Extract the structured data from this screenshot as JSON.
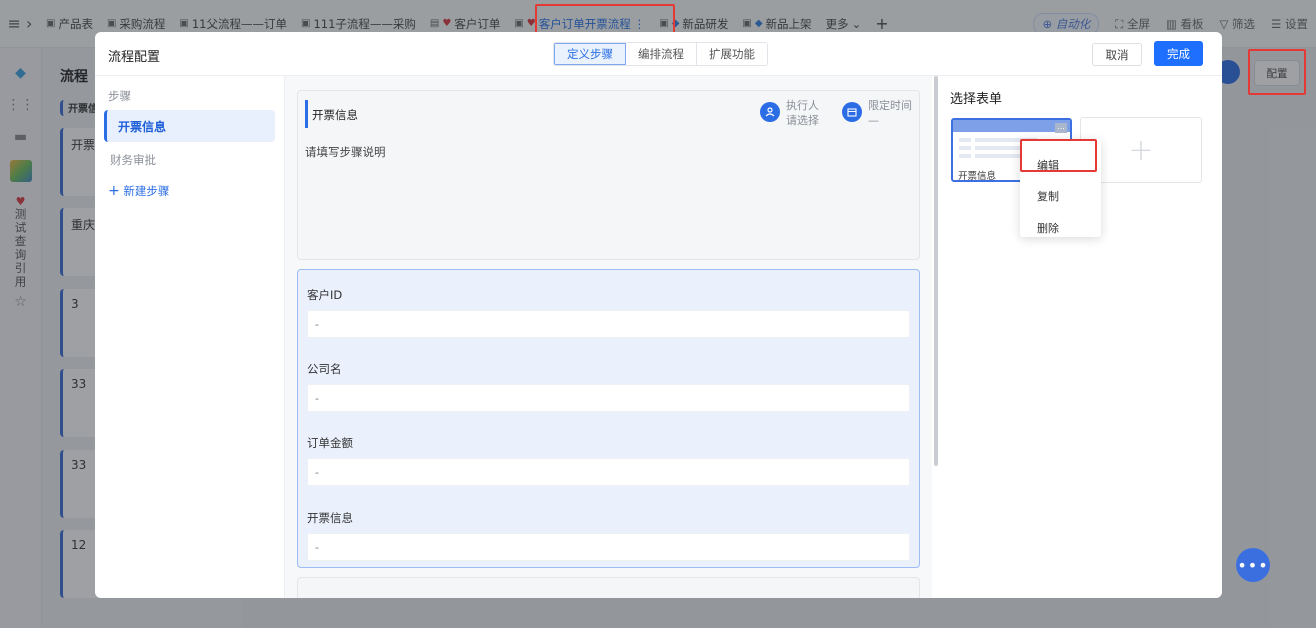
{
  "topbar": {
    "tabs": [
      {
        "label": "产品表",
        "icon": "doc-icon"
      },
      {
        "label": "采购流程",
        "icon": "flow-icon"
      },
      {
        "label": "11父流程——订单",
        "icon": "flow-icon"
      },
      {
        "label": "111子流程——采购",
        "icon": "flow-icon"
      },
      {
        "label": "客户订单",
        "icon": "heart-icon"
      },
      {
        "label": "客户订单开票流程",
        "icon": "heart-icon"
      },
      {
        "label": "新品研发",
        "icon": "gem-icon"
      },
      {
        "label": "新品上架",
        "icon": "gem-icon"
      },
      {
        "label": "更多",
        "icon": "chevron-down-icon"
      }
    ],
    "right": {
      "automation": "自动化",
      "fullscreen": "全屏",
      "board": "看板",
      "filter": "筛选",
      "settings": "设置"
    }
  },
  "leftrail": {
    "vertical_label": "测试查询引用"
  },
  "background": {
    "title": "流程",
    "section": "开票信",
    "cards": [
      "开票",
      "重庆",
      "3",
      "33",
      "33",
      "12"
    ],
    "config_button": "配置"
  },
  "modal": {
    "title": "流程配置",
    "segments": [
      "定义步骤",
      "编排流程",
      "扩展功能"
    ],
    "cancel": "取消",
    "done": "完成",
    "steps_header": "步骤",
    "steps": [
      "开票信息",
      "财务审批"
    ],
    "add_step": "新建步骤",
    "step_card": {
      "title": "开票信息",
      "description": "请填写步骤说明",
      "executor_label": "执行人",
      "executor_value": "请选择",
      "time_label": "限定时间",
      "time_value": "—"
    },
    "fields": [
      {
        "label": "客户ID",
        "value": "-"
      },
      {
        "label": "公司名",
        "value": "-"
      },
      {
        "label": "订单金额",
        "value": "-"
      },
      {
        "label": "开票信息",
        "value": "-"
      }
    ],
    "select_form": {
      "title": "选择表单",
      "form_name": "开票信息",
      "more": "...",
      "add_symbol": "+"
    },
    "context_menu": [
      "编辑",
      "复制",
      "删除"
    ]
  },
  "colors": {
    "primary": "#1f6fff",
    "highlight": "#e53935",
    "active_bg": "#e9f0fd"
  }
}
